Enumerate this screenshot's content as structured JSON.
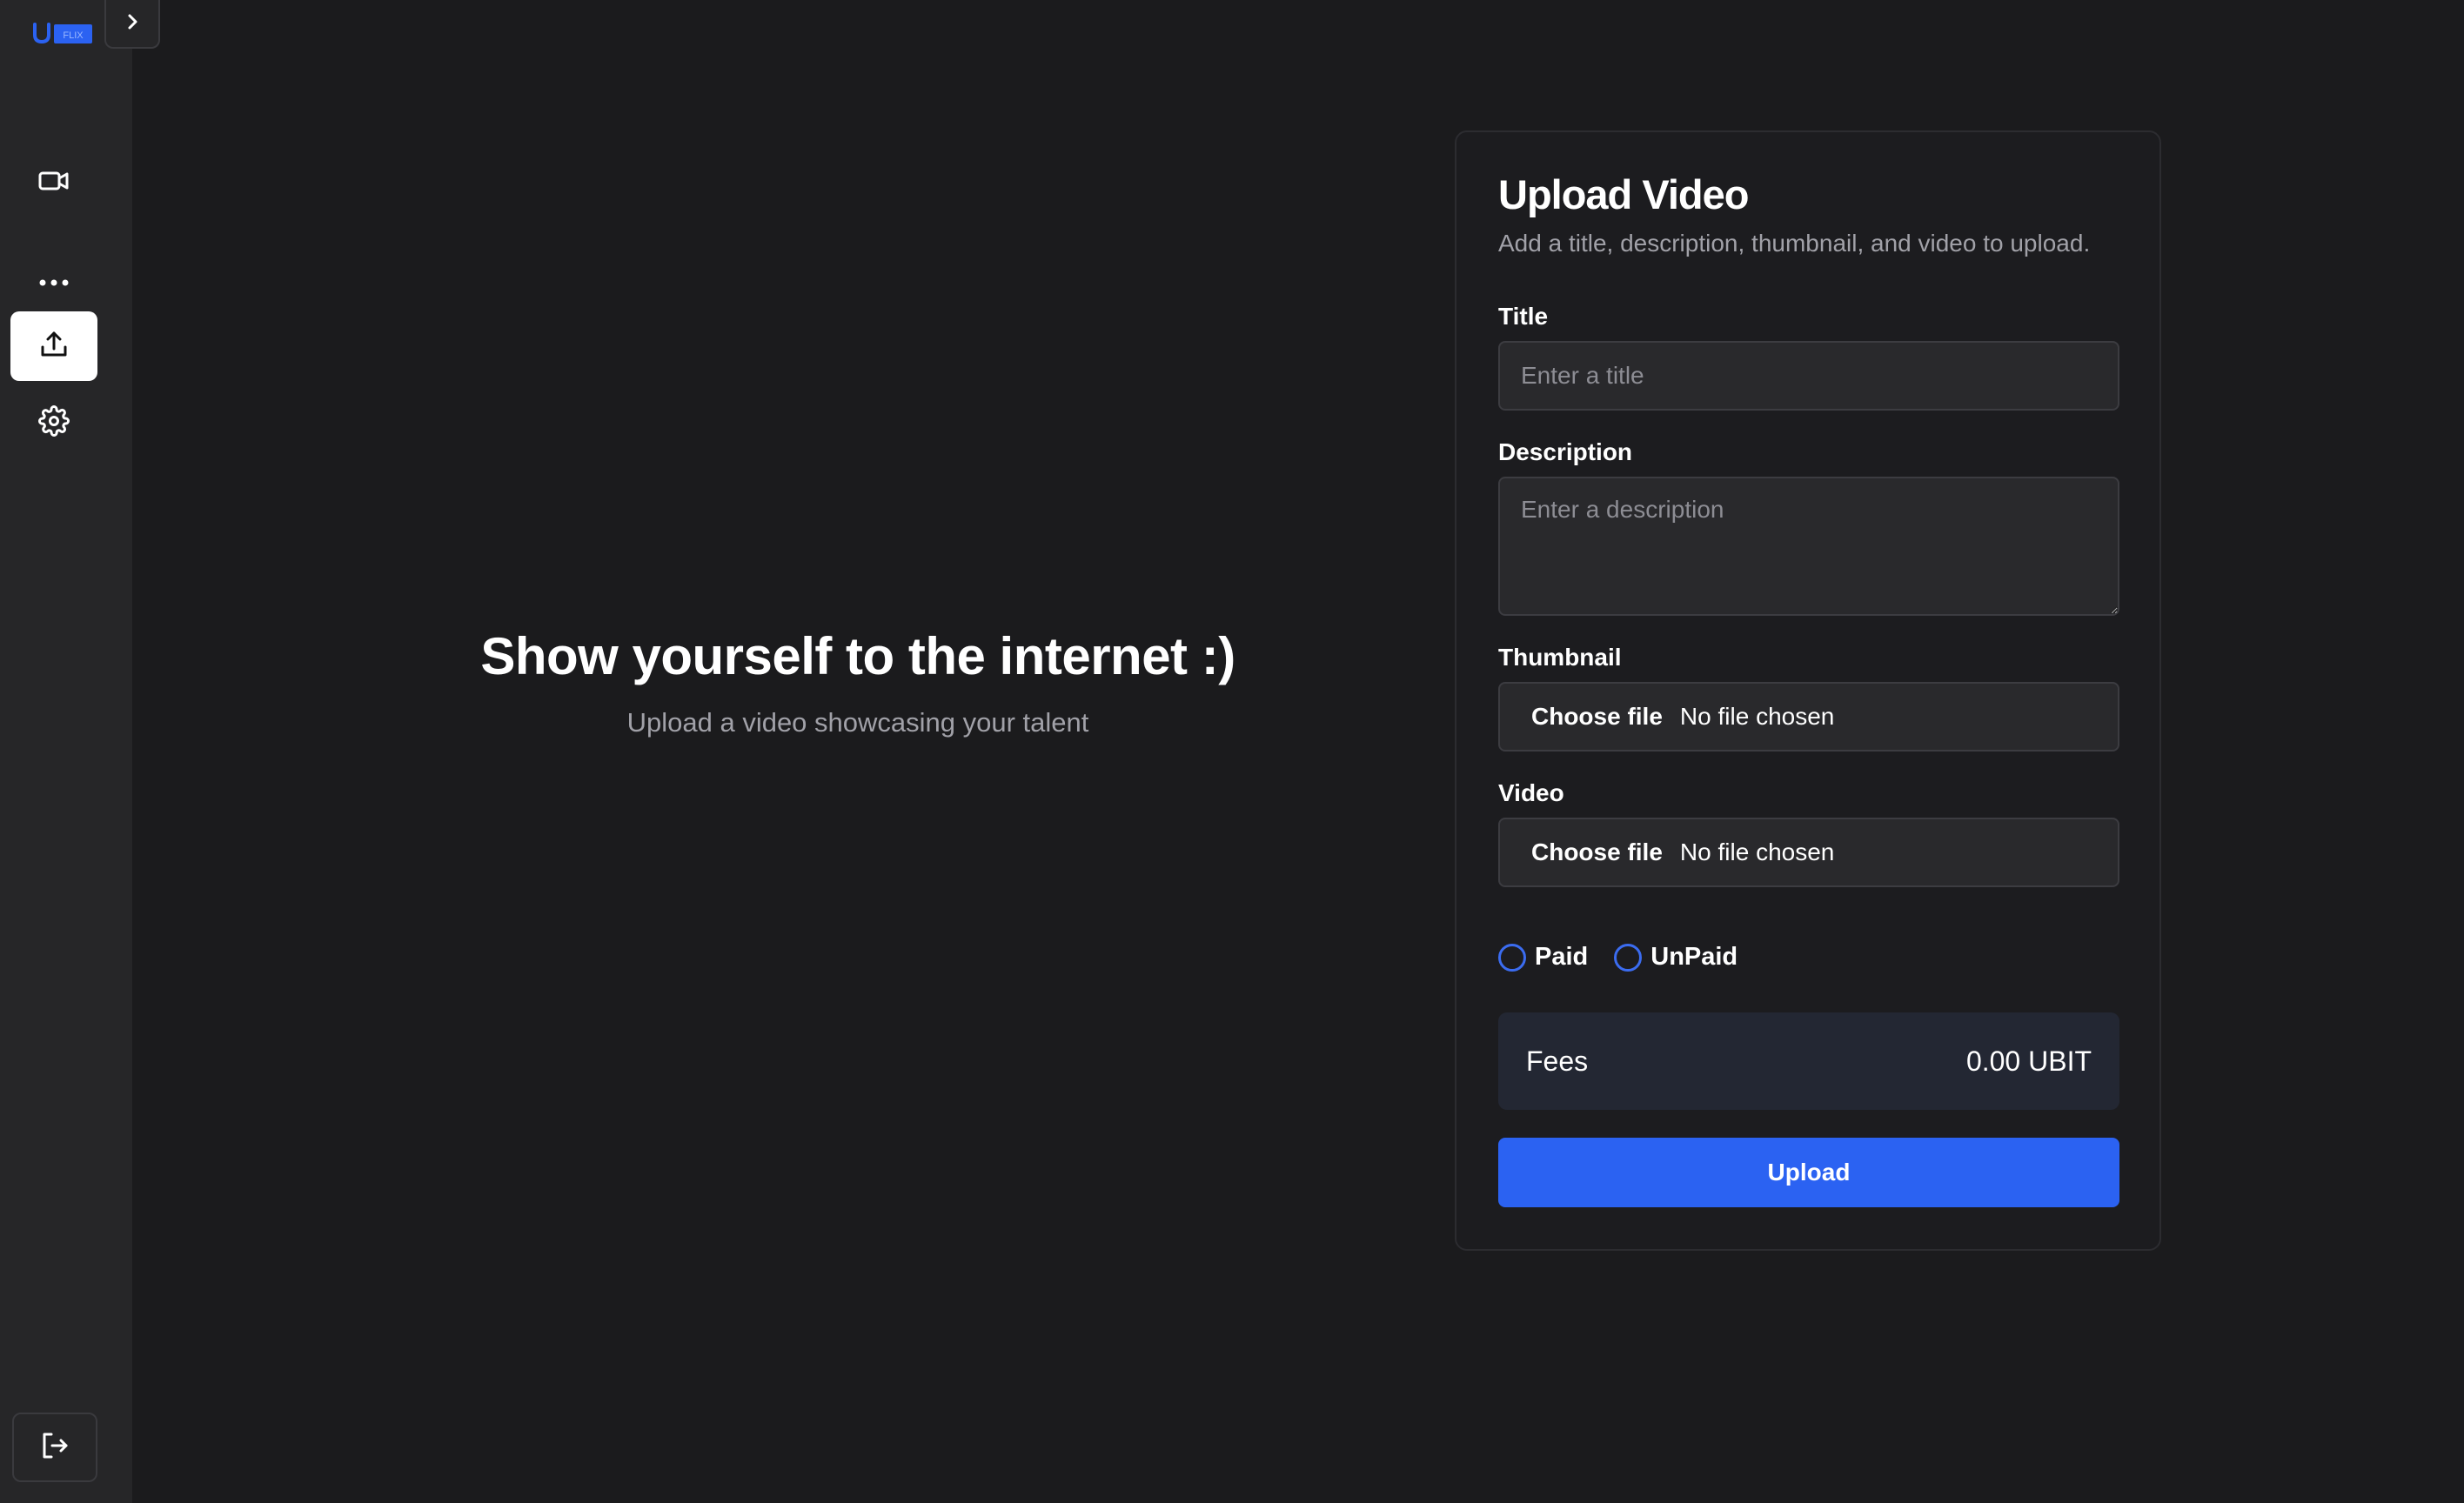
{
  "app": {
    "logo_text": "FLIX",
    "brand_color": "#2b62f2"
  },
  "sidebar": {
    "items": [
      {
        "icon": "video-camera-icon"
      },
      {
        "icon": "more-dots-icon"
      },
      {
        "icon": "upload-icon",
        "active": true
      },
      {
        "icon": "gear-icon"
      }
    ],
    "logout_icon": "logout-icon"
  },
  "hero": {
    "title": "Show yourself to the internet :)",
    "subtitle": "Upload a video showcasing your talent"
  },
  "form": {
    "title": "Upload Video",
    "subtitle": "Add a title, description, thumbnail, and video to upload.",
    "title_label": "Title",
    "title_placeholder": "Enter a title",
    "description_label": "Description",
    "description_placeholder": "Enter a description",
    "thumbnail_label": "Thumbnail",
    "video_label": "Video",
    "choose_file": "Choose file",
    "no_file": "No file chosen",
    "paid_label": "Paid",
    "unpaid_label": "UnPaid",
    "fees_label": "Fees",
    "fees_value": "0.00 UBIT",
    "upload_label": "Upload"
  }
}
